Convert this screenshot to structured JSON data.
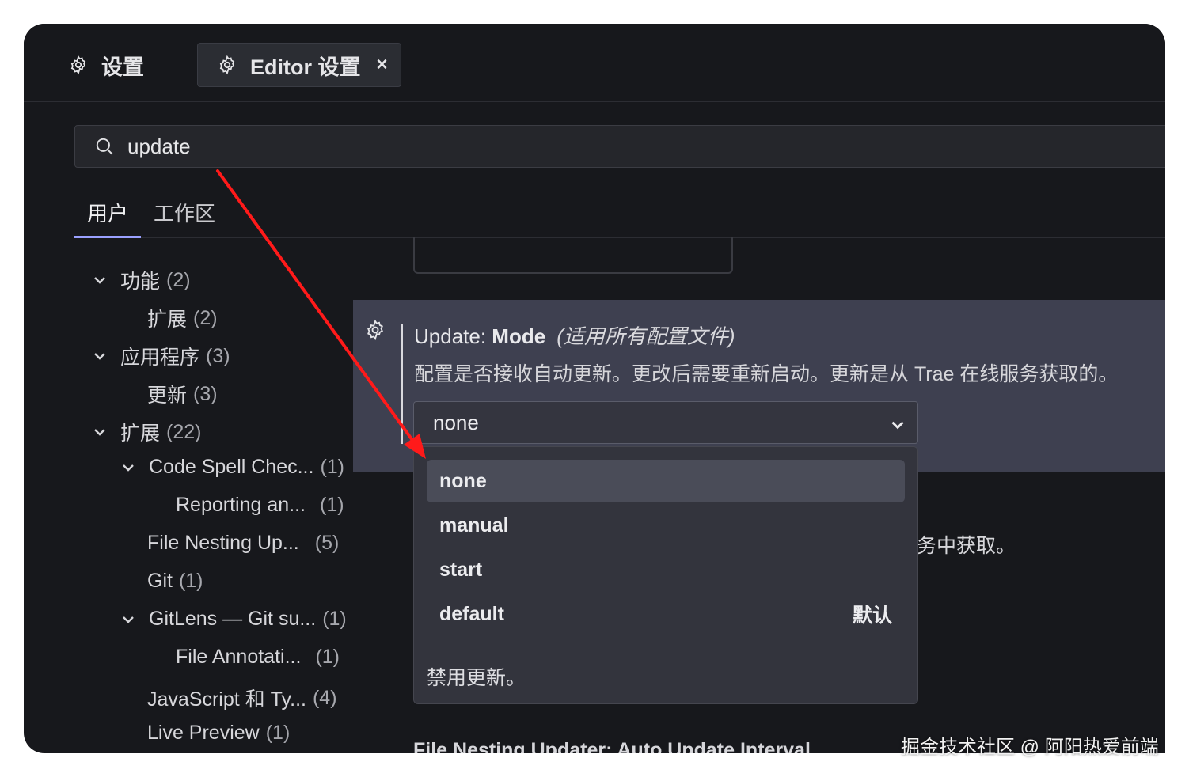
{
  "tabs": [
    {
      "label": "设置",
      "icon": "gear-icon",
      "active": false
    },
    {
      "label": "Editor 设置",
      "icon": "gear-icon",
      "active": true,
      "close": "×"
    }
  ],
  "search": {
    "value": "update",
    "icon": "search-icon"
  },
  "scope_tabs": [
    {
      "label": "用户",
      "active": true
    },
    {
      "label": "工作区",
      "active": false
    }
  ],
  "tree": [
    {
      "label": "功能",
      "count": "(2)",
      "level": 0,
      "expanded": true
    },
    {
      "label": "扩展",
      "count": "(2)",
      "level": 1
    },
    {
      "label": "应用程序",
      "count": "(3)",
      "level": 0,
      "expanded": true
    },
    {
      "label": "更新",
      "count": "(3)",
      "level": 1
    },
    {
      "label": "扩展",
      "count": "(22)",
      "level": 0,
      "expanded": true
    },
    {
      "label": "Code Spell Chec...",
      "count": "(1)",
      "level": 1,
      "expanded": true
    },
    {
      "label": "Reporting an...",
      "count": "(1)",
      "level": 2
    },
    {
      "label": "File Nesting Up...",
      "count": "(5)",
      "level": 1
    },
    {
      "label": "Git",
      "count": "(1)",
      "level": 1
    },
    {
      "label": "GitLens — Git su...",
      "count": "(1)",
      "level": 1,
      "expanded": true
    },
    {
      "label": "File Annotati...",
      "count": "(1)",
      "level": 2
    },
    {
      "label": "JavaScript 和 Ty...",
      "count": "(4)",
      "level": 1
    },
    {
      "label": "Live Preview",
      "count": "(1)",
      "level": 1
    }
  ],
  "setting": {
    "category": "Update: ",
    "name": "Mode",
    "scope_note": "(适用所有配置文件)",
    "description": "配置是否接收自动更新。更改后需要重新启动。更新是从 Trae 在线服务获取的。",
    "value": "none"
  },
  "dropdown": {
    "options": [
      {
        "label": "none",
        "selected": true,
        "tag": ""
      },
      {
        "label": "manual",
        "selected": false,
        "tag": ""
      },
      {
        "label": "start",
        "selected": false,
        "tag": ""
      },
      {
        "label": "default",
        "selected": false,
        "tag": "默认"
      }
    ],
    "option_description": "禁用更新。"
  },
  "behind_text": "务中获取。",
  "cut_text": "File Nesting Updater: Auto Update Interval",
  "watermark": "掘金技术社区 @ 阿阳热爱前端",
  "colors": {
    "accent": "#9aa0ff",
    "annotation_arrow": "#ff1a1a",
    "window_bg": "#17181c",
    "setting_bg": "#3e4050"
  }
}
